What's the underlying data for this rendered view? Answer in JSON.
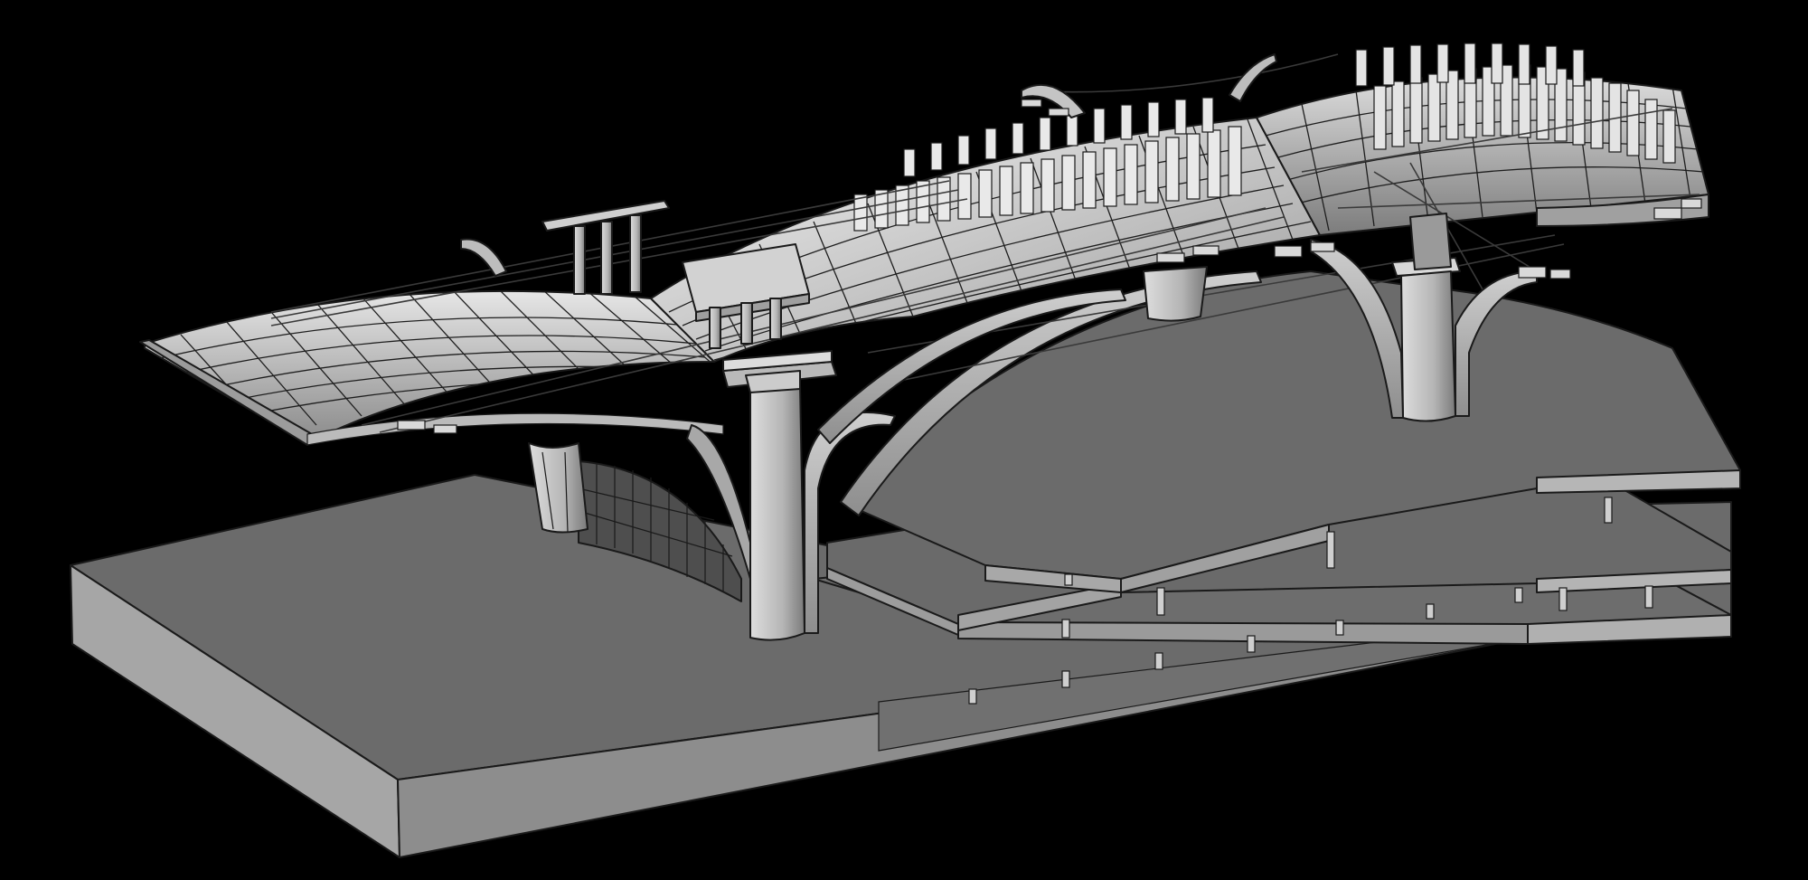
{
  "scene": {
    "subject": "architectural-3d-model",
    "background_color": "#000000",
    "colors": {
      "slab_top": "#6b6b6b",
      "slab_front": "#a9a9a9",
      "slab_side": "#8c8c8c",
      "roof_light": "#f2f2f2",
      "roof_mid": "#cfcfcf",
      "roof_dark": "#8f8f8f",
      "column": "#bdbdbd",
      "line": "#1a1a1a"
    },
    "components": {
      "floor_levels": 3,
      "main_columns": 4,
      "roof_shells": 3,
      "skylight_stacks": 2
    }
  }
}
